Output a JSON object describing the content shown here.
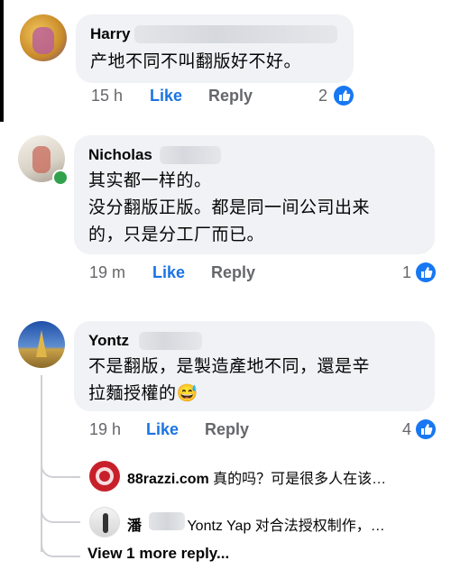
{
  "comments": [
    {
      "author": "Harry",
      "lines": [
        "产地不同不叫翻版好不好。"
      ],
      "time": "15 h",
      "like_label": "Like",
      "reply_label": "Reply",
      "like_count": "2"
    },
    {
      "author": "Nicholas",
      "lines": [
        "其实都一样的。",
        "没分翻版正版。都是同一间公司出来",
        "的，只是分工厂而已。"
      ],
      "time": "19 m",
      "like_label": "Like",
      "reply_label": "Reply",
      "like_count": "1"
    },
    {
      "author": "Yontz",
      "lines": [
        "不是翻版，是製造產地不同，還是辛",
        "拉麵授權的😅"
      ],
      "time": "19 h",
      "like_label": "Like",
      "reply_label": "Reply",
      "like_count": "4"
    }
  ],
  "replies": [
    {
      "author": "88razzi.com",
      "text": "真的吗？可是很多人在该…"
    },
    {
      "author": "潘",
      "text": "Yontz Yap 对合法授权制作，…"
    }
  ],
  "view_more_label": "View 1 more reply...",
  "colors": {
    "bubble": "#f0f2f5",
    "like_blue": "#1877f2",
    "meta_gray": "#65676b",
    "online_green": "#31a24c"
  }
}
